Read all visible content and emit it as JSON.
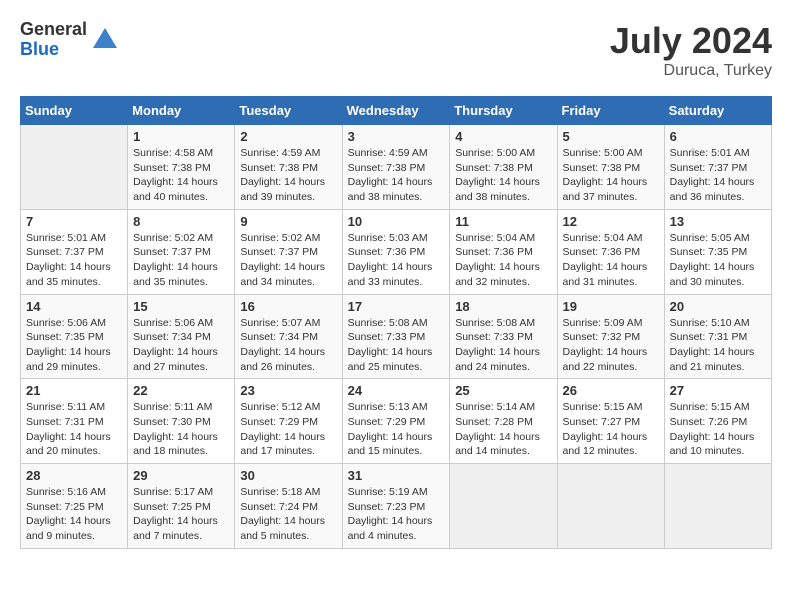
{
  "header": {
    "logo_general": "General",
    "logo_blue": "Blue",
    "month_title": "July 2024",
    "location": "Duruca, Turkey"
  },
  "calendar": {
    "days_of_week": [
      "Sunday",
      "Monday",
      "Tuesday",
      "Wednesday",
      "Thursday",
      "Friday",
      "Saturday"
    ],
    "weeks": [
      [
        {
          "day": "",
          "info": ""
        },
        {
          "day": "1",
          "info": "Sunrise: 4:58 AM\nSunset: 7:38 PM\nDaylight: 14 hours\nand 40 minutes."
        },
        {
          "day": "2",
          "info": "Sunrise: 4:59 AM\nSunset: 7:38 PM\nDaylight: 14 hours\nand 39 minutes."
        },
        {
          "day": "3",
          "info": "Sunrise: 4:59 AM\nSunset: 7:38 PM\nDaylight: 14 hours\nand 38 minutes."
        },
        {
          "day": "4",
          "info": "Sunrise: 5:00 AM\nSunset: 7:38 PM\nDaylight: 14 hours\nand 38 minutes."
        },
        {
          "day": "5",
          "info": "Sunrise: 5:00 AM\nSunset: 7:38 PM\nDaylight: 14 hours\nand 37 minutes."
        },
        {
          "day": "6",
          "info": "Sunrise: 5:01 AM\nSunset: 7:37 PM\nDaylight: 14 hours\nand 36 minutes."
        }
      ],
      [
        {
          "day": "7",
          "info": "Sunrise: 5:01 AM\nSunset: 7:37 PM\nDaylight: 14 hours\nand 35 minutes."
        },
        {
          "day": "8",
          "info": "Sunrise: 5:02 AM\nSunset: 7:37 PM\nDaylight: 14 hours\nand 35 minutes."
        },
        {
          "day": "9",
          "info": "Sunrise: 5:02 AM\nSunset: 7:37 PM\nDaylight: 14 hours\nand 34 minutes."
        },
        {
          "day": "10",
          "info": "Sunrise: 5:03 AM\nSunset: 7:36 PM\nDaylight: 14 hours\nand 33 minutes."
        },
        {
          "day": "11",
          "info": "Sunrise: 5:04 AM\nSunset: 7:36 PM\nDaylight: 14 hours\nand 32 minutes."
        },
        {
          "day": "12",
          "info": "Sunrise: 5:04 AM\nSunset: 7:36 PM\nDaylight: 14 hours\nand 31 minutes."
        },
        {
          "day": "13",
          "info": "Sunrise: 5:05 AM\nSunset: 7:35 PM\nDaylight: 14 hours\nand 30 minutes."
        }
      ],
      [
        {
          "day": "14",
          "info": "Sunrise: 5:06 AM\nSunset: 7:35 PM\nDaylight: 14 hours\nand 29 minutes."
        },
        {
          "day": "15",
          "info": "Sunrise: 5:06 AM\nSunset: 7:34 PM\nDaylight: 14 hours\nand 27 minutes."
        },
        {
          "day": "16",
          "info": "Sunrise: 5:07 AM\nSunset: 7:34 PM\nDaylight: 14 hours\nand 26 minutes."
        },
        {
          "day": "17",
          "info": "Sunrise: 5:08 AM\nSunset: 7:33 PM\nDaylight: 14 hours\nand 25 minutes."
        },
        {
          "day": "18",
          "info": "Sunrise: 5:08 AM\nSunset: 7:33 PM\nDaylight: 14 hours\nand 24 minutes."
        },
        {
          "day": "19",
          "info": "Sunrise: 5:09 AM\nSunset: 7:32 PM\nDaylight: 14 hours\nand 22 minutes."
        },
        {
          "day": "20",
          "info": "Sunrise: 5:10 AM\nSunset: 7:31 PM\nDaylight: 14 hours\nand 21 minutes."
        }
      ],
      [
        {
          "day": "21",
          "info": "Sunrise: 5:11 AM\nSunset: 7:31 PM\nDaylight: 14 hours\nand 20 minutes."
        },
        {
          "day": "22",
          "info": "Sunrise: 5:11 AM\nSunset: 7:30 PM\nDaylight: 14 hours\nand 18 minutes."
        },
        {
          "day": "23",
          "info": "Sunrise: 5:12 AM\nSunset: 7:29 PM\nDaylight: 14 hours\nand 17 minutes."
        },
        {
          "day": "24",
          "info": "Sunrise: 5:13 AM\nSunset: 7:29 PM\nDaylight: 14 hours\nand 15 minutes."
        },
        {
          "day": "25",
          "info": "Sunrise: 5:14 AM\nSunset: 7:28 PM\nDaylight: 14 hours\nand 14 minutes."
        },
        {
          "day": "26",
          "info": "Sunrise: 5:15 AM\nSunset: 7:27 PM\nDaylight: 14 hours\nand 12 minutes."
        },
        {
          "day": "27",
          "info": "Sunrise: 5:15 AM\nSunset: 7:26 PM\nDaylight: 14 hours\nand 10 minutes."
        }
      ],
      [
        {
          "day": "28",
          "info": "Sunrise: 5:16 AM\nSunset: 7:25 PM\nDaylight: 14 hours\nand 9 minutes."
        },
        {
          "day": "29",
          "info": "Sunrise: 5:17 AM\nSunset: 7:25 PM\nDaylight: 14 hours\nand 7 minutes."
        },
        {
          "day": "30",
          "info": "Sunrise: 5:18 AM\nSunset: 7:24 PM\nDaylight: 14 hours\nand 5 minutes."
        },
        {
          "day": "31",
          "info": "Sunrise: 5:19 AM\nSunset: 7:23 PM\nDaylight: 14 hours\nand 4 minutes."
        },
        {
          "day": "",
          "info": ""
        },
        {
          "day": "",
          "info": ""
        },
        {
          "day": "",
          "info": ""
        }
      ]
    ]
  }
}
